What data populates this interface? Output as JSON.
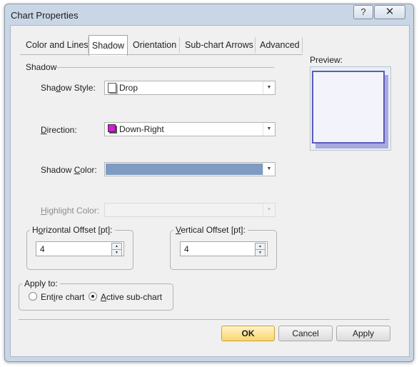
{
  "window": {
    "title": "Chart Properties",
    "help": "?",
    "close": "✕"
  },
  "tabs": [
    "Color and Lines",
    "Shadow",
    "Orientation",
    "Sub-chart Arrows",
    "Advanced"
  ],
  "shadow_group": {
    "label": "Shadow"
  },
  "fields": {
    "style_label_pre": "Sha",
    "style_label_u": "d",
    "style_label_post": "ow Style:",
    "style_value": "Drop",
    "direction_label_u": "D",
    "direction_label_post": "irection:",
    "direction_value": "Down-Right",
    "color_label_pre": "Shadow ",
    "color_label_u": "C",
    "color_label_post": "olor:",
    "color_value": "#7f9bc2",
    "highlight_label_u": "H",
    "highlight_label_post": "ighlight Color:"
  },
  "offsets": {
    "horizontal_label_pre": "H",
    "horizontal_label_u": "o",
    "horizontal_label_post": "rizontal Offset [pt]:",
    "horizontal_value": "4",
    "vertical_label_u": "V",
    "vertical_label_post": "ertical Offset [pt]:",
    "vertical_value": "4"
  },
  "apply_to": {
    "label": "Apply to:",
    "entire_pre": "Ent",
    "entire_u": "i",
    "entire_post": "re chart",
    "active_u": "A",
    "active_post": "ctive sub-chart",
    "selected": "active"
  },
  "preview": {
    "label": "Preview:",
    "fill": "#f3f3fb",
    "border": "#5b5bbf",
    "shadow": "#a9a9dd"
  },
  "buttons": {
    "ok": "OK",
    "cancel": "Cancel",
    "apply": "Apply"
  },
  "colors": {
    "direction_swatch": "#d91ad9"
  }
}
